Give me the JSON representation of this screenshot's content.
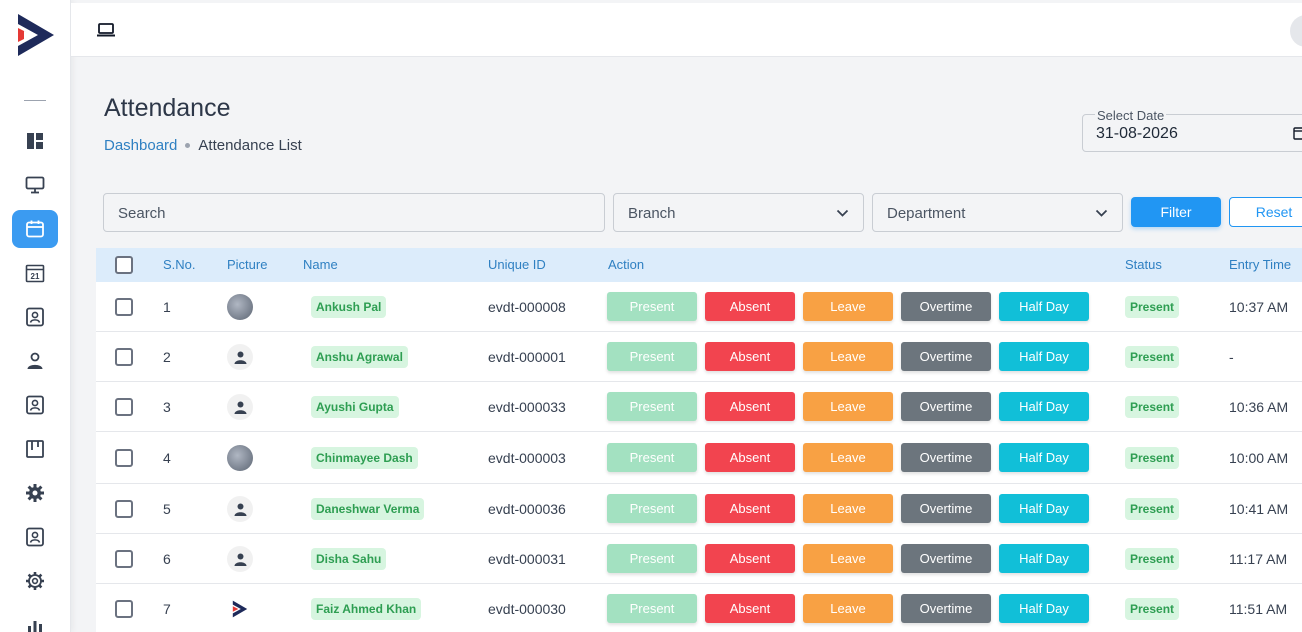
{
  "sidebar": {
    "logo_name": "brand-logo",
    "icons": [
      {
        "name": "dashboard-icon",
        "active": false
      },
      {
        "name": "monitor-icon",
        "active": false
      },
      {
        "name": "calendar-icon",
        "active": true
      },
      {
        "name": "calendar-date-icon",
        "active": false
      },
      {
        "name": "contact-card-icon",
        "active": false
      },
      {
        "name": "user-icon",
        "active": false
      },
      {
        "name": "contact-card-icon",
        "active": false
      },
      {
        "name": "board-icon",
        "active": false
      },
      {
        "name": "gear-icon",
        "active": false
      },
      {
        "name": "contact-card-icon",
        "active": false
      },
      {
        "name": "settings-cog-icon",
        "active": false
      },
      {
        "name": "chart-icon",
        "active": false
      }
    ]
  },
  "topbar": {
    "icon": "laptop-icon"
  },
  "header": {
    "title": "Attendance",
    "breadcrumb": {
      "link": "Dashboard",
      "current": "Attendance List"
    },
    "date": {
      "label": "Select Date",
      "value": "31-08-2026"
    }
  },
  "filters": {
    "search_placeholder": "Search",
    "branch_placeholder": "Branch",
    "department_placeholder": "Department",
    "filter_label": "Filter",
    "reset_label": "Reset"
  },
  "table": {
    "columns": {
      "sno": "S.No.",
      "picture": "Picture",
      "name": "Name",
      "unique_id": "Unique ID",
      "action": "Action",
      "status": "Status",
      "entry_time": "Entry Time"
    },
    "action_labels": {
      "present": "Present",
      "absent": "Absent",
      "leave": "Leave",
      "overtime": "Overtime",
      "halfday": "Half Day"
    },
    "rows": [
      {
        "sno": "1",
        "picture": "photo",
        "name": "Ankush Pal",
        "uid": "evdt-000008",
        "status": "Present",
        "entry": "10:37 AM"
      },
      {
        "sno": "2",
        "picture": "placeholder",
        "name": "Anshu Agrawal",
        "uid": "evdt-000001",
        "status": "Present",
        "entry": "-"
      },
      {
        "sno": "3",
        "picture": "placeholder",
        "name": "Ayushi Gupta",
        "uid": "evdt-000033",
        "status": "Present",
        "entry": "10:36 AM"
      },
      {
        "sno": "4",
        "picture": "photo",
        "name": "Chinmayee Dash",
        "uid": "evdt-000003",
        "status": "Present",
        "entry": "10:00 AM"
      },
      {
        "sno": "5",
        "picture": "placeholder",
        "name": "Daneshwar Verma",
        "uid": "evdt-000036",
        "status": "Present",
        "entry": "10:41 AM"
      },
      {
        "sno": "6",
        "picture": "placeholder",
        "name": "Disha Sahu",
        "uid": "evdt-000031",
        "status": "Present",
        "entry": "11:17 AM"
      },
      {
        "sno": "7",
        "picture": "logo",
        "name": "Faiz Ahmed Khan",
        "uid": "evdt-000030",
        "status": "Present",
        "entry": "11:51 AM"
      }
    ]
  },
  "colors": {
    "accent": "#2196f3",
    "header_row": "#dcecfb",
    "present": "#a3e1c1",
    "absent": "#f2444f",
    "leave": "#f8a144",
    "overtime": "#6c757d",
    "halfday": "#11bfd8",
    "badge_bg": "#d7f5e0",
    "badge_text": "#2e9e52"
  }
}
